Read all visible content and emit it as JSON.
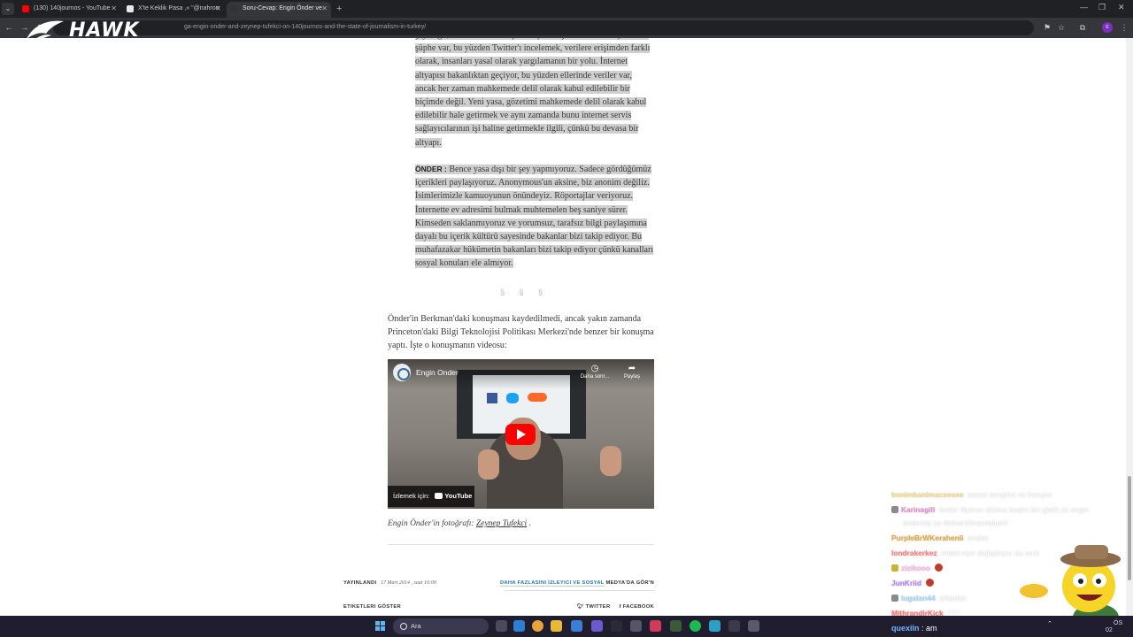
{
  "browser": {
    "tabs": [
      {
        "title": "(130) 140journos - YouTube",
        "favicon_color": "#ff0000"
      },
      {
        "title": "X'te Keklik Pasa ,« \"@nahronst",
        "favicon_color": "#e8e8e8"
      },
      {
        "title": "Soru-Cevap: Engin Önder ve Ze",
        "favicon_color": "#333333"
      }
    ],
    "url": "ga-engin-onder-and-zeynep-tufekci-on-140journos-and-the-state-of-journalism-in-turkey/",
    "profile_initial": "c"
  },
  "watermark": {
    "text": "HAWK"
  },
  "article": {
    "paragraph_1": "şey değil, fakat interneti başka bir yere taşımalarına dair çok fazla şüphe var, bu yüzden Twitter'ı incelemek, verilere erişimden farklı olarak, insanları yasal olarak yargılamanın bir yolu. İnternet altyapısı bakanlıktan geçiyor, bu yüzden ellerinde veriler var, ancak her zaman mahkemede delil olarak kabul edilebilir bir biçimde değil. Yeni yasa, gözetimi mahkemede delil olarak kabul edilebilir hale getirmek ve aynı zamanda bunu internet servis sağlayıcılarının işi haline getirmekle ilgili, çünkü bu devasa bir altyapı.",
    "speaker": "ÖNDER :",
    "paragraph_2": "Bence yasa dışı bir şey yapmıyoruz. Sadece gördüğümüz içerikleri paylaşıyoruz. Anonymous'un aksine, biz anonim değiliz. İsimlerimizle kamuoyunun önündeyiz. Röportajlar veriyoruz. İnternette ev adresimi bulmak muhtemelen beş saniye sürer. Kimseden saklanmıyoruz ve yorumsuz, tarafsız bilgi paylaşımına dayalı bu içerik kültürü sayesinde bakanlar bizi takip ediyor. Bu muhafazakar hükümetin bakanları bizi takip ediyor çünkü kanalları sosyal konuları ele almıyor.",
    "separator": "§ § §",
    "paragraph_3": "Önder'in Berkman'daki konuşması kaydedilmedi, ancak yakın zamanda Princeton'daki Bilgi Teknolojisi Politikası Merkezi'nde benzer bir konuşma yaptı. İşte o konuşmanın videosu:",
    "video": {
      "channel_title": "Engin Onder",
      "watch_later": "Daha sonr...",
      "share": "Paylaş",
      "watch_on": "İzlemek için:",
      "youtube": "YouTube"
    },
    "caption_prefix": "Engin Önder'in fotoğrafı:",
    "caption_link": "Zeynep Tufekci",
    "caption_suffix": ".",
    "meta": {
      "published_label": "YAYINLANDI",
      "date": "17 Mart 2014 , saat 10:00",
      "more_prefix": "DAHA FAZLASINI",
      "more_link": "İZLEYICI VE SOSYAL",
      "more_suffix": "MEDYA'DA GÖR'N",
      "tags_label": "ETIKETLERI GÖSTER",
      "twitter": "TWITTER",
      "facebook": "FACEBOOK"
    }
  },
  "chat": [
    {
      "user": "benimkanimacsesee",
      "text": ": sevan sevgilisi mi koruyor",
      "color": "#f2dc8a"
    },
    {
      "user": "Karinagill",
      "text": ": önder diyince aklıma başka biri geldi ya engin",
      "color": "#e58ad0"
    },
    {
      "user": "",
      "text": "önderniş ya ilkönordönarmdıarıf",
      "color": "#ffffff"
    },
    {
      "user": "PurpleBrWKerahenli",
      "text": ": önden",
      "color": "#e6a93a"
    },
    {
      "user": "londrakerkez",
      "text": ": metni niye değiştiriyor bu amk",
      "color": "#ff7a7a"
    },
    {
      "user": "zizikooo",
      "text": ":",
      "color": "#ffb0e0"
    },
    {
      "user": "JunKriid",
      "text": ":",
      "color": "#b080ff"
    },
    {
      "user": "lugalan44",
      "text": ": arkadan",
      "color": "#9fd7ff"
    },
    {
      "user": "MithrandirKick",
      "text": ": ???",
      "color": "#ff6a6a"
    }
  ],
  "chat_last": {
    "user": "quexiln",
    "text": ": am"
  },
  "taskbar": {
    "search_placeholder": "Ara",
    "lang": "ÖS",
    "time": "02"
  },
  "colors": {
    "accent_link": "#1f7bb6",
    "highlight": "#cfcfcf",
    "taskbar": "#1f1d2e"
  }
}
